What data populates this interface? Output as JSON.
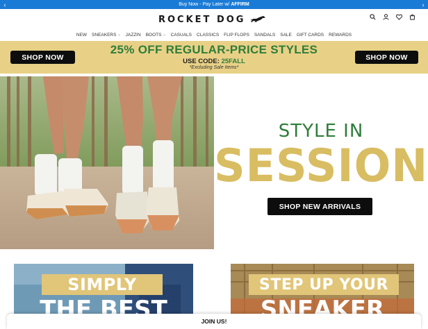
{
  "announcement": {
    "text_prefix": "Buy Now - Pay Later w/ ",
    "text_brand": "AFFIRM"
  },
  "header": {
    "logo": "ROCKET DOG"
  },
  "nav": {
    "items": [
      "NEW",
      "SNEAKERS",
      "JAZZIN",
      "BOOTS",
      "CASUALS",
      "CLASSICS",
      "FLIP FLOPS",
      "SANDALS",
      "SALE",
      "GIFT CARDS",
      "REWARDS"
    ]
  },
  "promo": {
    "shop_left": "SHOP NOW",
    "shop_right": "SHOP NOW",
    "headline": "25% OFF REGULAR-PRICE STYLES",
    "code_label": "USE CODE: ",
    "code_value": "25FALL",
    "exclusion": "*Excluding Sale Items*"
  },
  "hero": {
    "line1": "STYLE IN",
    "line2": "SESSION",
    "button": "SHOP NEW ARRIVALS"
  },
  "cards": [
    {
      "banner": "SIMPLY",
      "big": "THE BEST"
    },
    {
      "banner": "STEP UP YOUR",
      "big": "SNEAKER"
    }
  ],
  "join": "JOIN US!",
  "colors": {
    "announce_bg": "#1a7bd6",
    "promo_bg": "#e8d186",
    "promo_green": "#2e7d3a",
    "session_gold": "#d9bd63"
  }
}
